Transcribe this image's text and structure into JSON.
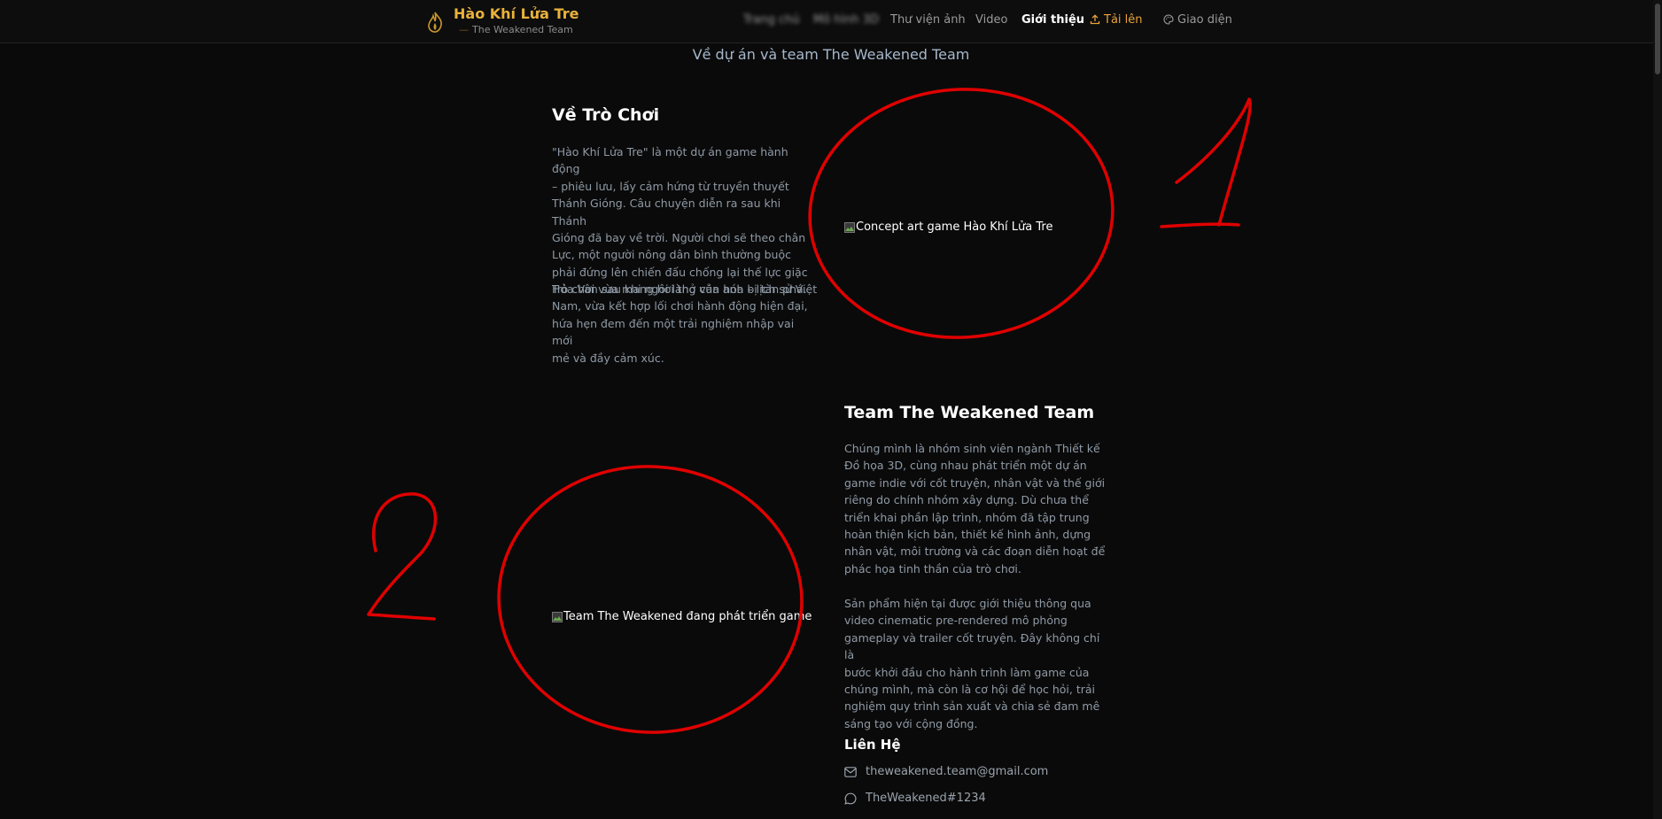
{
  "brand": {
    "title": "Hào Khí Lửa Tre",
    "subtitle": "The Weakened Team",
    "logo_icon": "flame-leaf-icon"
  },
  "nav": {
    "home": "Trang chủ",
    "models": "Mô hình 3D",
    "gallery": "Thư viện ảnh",
    "video": "Video",
    "about": "Giới thiệu",
    "upload": "Tải lên",
    "theme": "Giao diện"
  },
  "page": {
    "subheading": "Về dự án và team The Weakened Team"
  },
  "game": {
    "title": "Về Trò Chơi",
    "para1_lines": [
      "\"Hào Khí Lửa Tre\" là một dự án game hành động",
      "– phiêu lưu, lấy cảm hứng từ truyền thuyết",
      "Thánh Gióng. Câu chuyện diễn ra sau khi Thánh",
      "Gióng đã bay về trời. Người chơi sẽ theo chân",
      "Lực, một người nông dân bình thường buộc",
      "phải đứng lên chiến đấu chống lại thế lực giặc",
      "Hỏa Vân sau khi ngôi làng của anh bị tàn phá."
    ],
    "para2_lines": [
      "Trò chơi vừa mang hơi thở văn hóa – lịch sử Việt",
      "Nam, vừa kết hợp lối chơi hành động hiện đại,",
      "hứa hẹn đem đến một trải nghiệm nhập vai mới",
      "mẻ và đầy cảm xúc."
    ],
    "image_alt": "Concept art game Hào Khí Lửa Tre"
  },
  "team": {
    "title": "Team The Weakened Team",
    "para1_lines": [
      "Chúng mình là nhóm sinh viên ngành Thiết kế",
      "Đồ họa 3D, cùng nhau phát triển một dự án",
      "game indie với cốt truyện, nhân vật và thế giới",
      "riêng do chính nhóm xây dựng. Dù chưa thể",
      "triển khai phần lập trình, nhóm đã tập trung",
      "hoàn thiện kịch bản, thiết kế hình ảnh, dựng",
      "nhân vật, môi trường và các đoạn diễn hoạt để",
      "phác họa tinh thần của trò chơi."
    ],
    "para2_lines": [
      "Sản phẩm hiện tại được giới thiệu thông qua",
      "video cinematic pre-rendered mô phỏng",
      "gameplay và trailer cốt truyện. Đây không chỉ là",
      "bước khởi đầu cho hành trình làm game của",
      "chúng mình, mà còn là cơ hội để học hỏi, trải",
      "nghiệm quy trình sản xuất và chia sẻ đam mê",
      "sáng tạo với cộng đồng."
    ],
    "image_alt": "Team The Weakened đang phát triển game"
  },
  "contact": {
    "title": "Liên Hệ",
    "email": "theweakened.team@gmail.com",
    "discord": "TheWeakened#1234"
  },
  "annotations": {
    "color": "#e00000",
    "label_1": "1",
    "label_2": "2"
  },
  "colors": {
    "background": "#0a0a0a",
    "brand": "#e9b23b",
    "accent": "#e9a23b"
  }
}
